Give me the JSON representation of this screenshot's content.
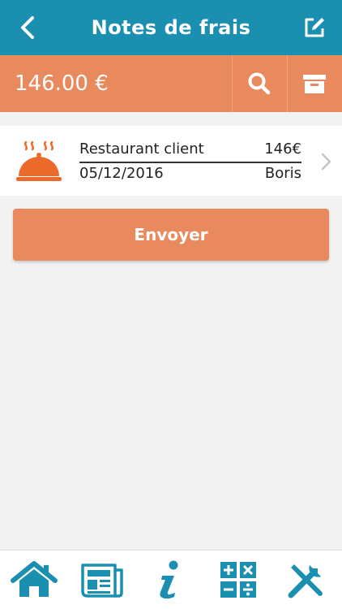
{
  "header": {
    "title": "Notes de frais"
  },
  "summary": {
    "total": "146.00 €"
  },
  "expenses": [
    {
      "name": "Restaurant client",
      "amount": "146€",
      "date": "05/12/2016",
      "person": "Boris",
      "icon": "restaurant-cloche-icon"
    }
  ],
  "actions": {
    "send_label": "Envoyer"
  },
  "tabbar": {
    "items": [
      {
        "icon": "home-icon"
      },
      {
        "icon": "newspaper-icon"
      },
      {
        "icon": "info-icon"
      },
      {
        "icon": "calculator-icon"
      },
      {
        "icon": "tools-icon"
      }
    ]
  },
  "colors": {
    "header": "#1a8fb0",
    "accent": "#e88a5d",
    "icon_orange": "#ec6a2c"
  }
}
